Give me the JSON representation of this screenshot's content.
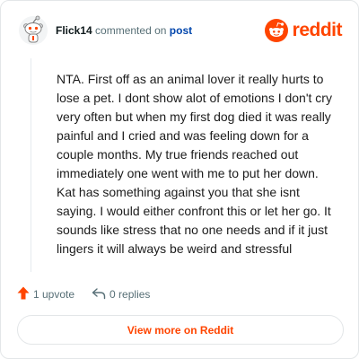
{
  "header": {
    "username": "Flick14",
    "commented_text": "commented on",
    "post_link": "post",
    "brand": "reddit"
  },
  "comment": {
    "body": "NTA. First off as an animal lover it really hurts to lose a pet. I dont show alot of emotions I don't cry very often but when my first dog died it was really painful and I cried and was feeling down for a couple months. My true friends reached out immediately one went with me to put her down. Kat has something against you that she isnt saying. I would either confront this or let her go. It sounds like stress that no one needs and if it just lingers it will always be weird and stressful"
  },
  "actions": {
    "upvotes": "1 upvote",
    "replies": "0 replies"
  },
  "footer": {
    "view_more": "View more on Reddit"
  },
  "colors": {
    "brand": "#ff4500",
    "link": "#0045ac",
    "muted": "#576f76"
  },
  "icons": [
    "snoo-avatar-icon",
    "reddit-logo-icon",
    "upvote-arrow-icon",
    "reply-arrow-icon"
  ]
}
